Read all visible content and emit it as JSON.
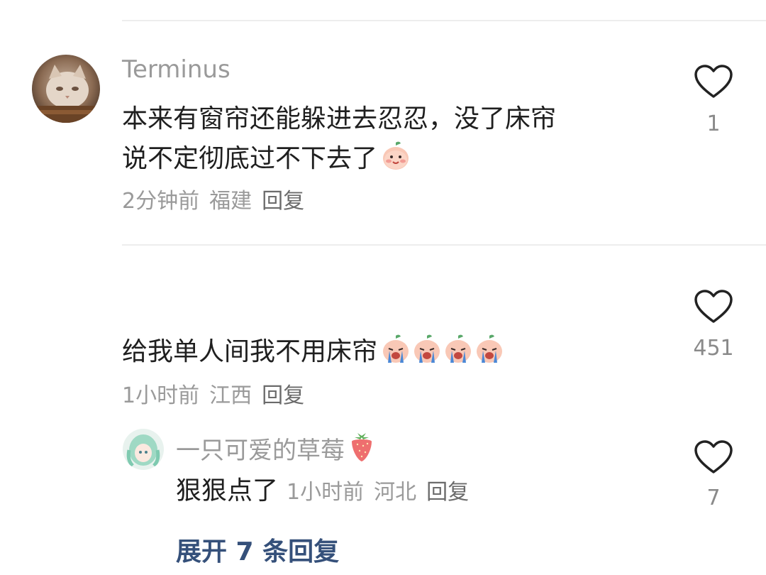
{
  "comments": [
    {
      "username": "Terminus",
      "text_line1": "本来有窗帘还能躲进去忍忍，没了床帘",
      "text_line2": "说不定彻底过不下去了",
      "time": "2分钟前",
      "location": "福建",
      "reply_label": "回复",
      "likes": "1"
    },
    {
      "text": "给我单人间我不用床帘",
      "time": "1小时前",
      "location": "江西",
      "reply_label": "回复",
      "likes": "451",
      "reply": {
        "username": "一只可爱的草莓",
        "text": "狠狠点了",
        "time": "1小时前",
        "location": "河北",
        "reply_label": "回复",
        "likes": "7"
      },
      "expand_label": "展开 7 条回复"
    }
  ],
  "icons": {
    "like": "heart-outline-icon",
    "emoji_smile": "peach-smile-emoji",
    "emoji_cry": "peach-crying-emoji",
    "strawberry": "strawberry-emoji"
  },
  "colors": {
    "text": "#1f1f1f",
    "meta": "#9a9a9a",
    "expand_link": "#35507a"
  }
}
